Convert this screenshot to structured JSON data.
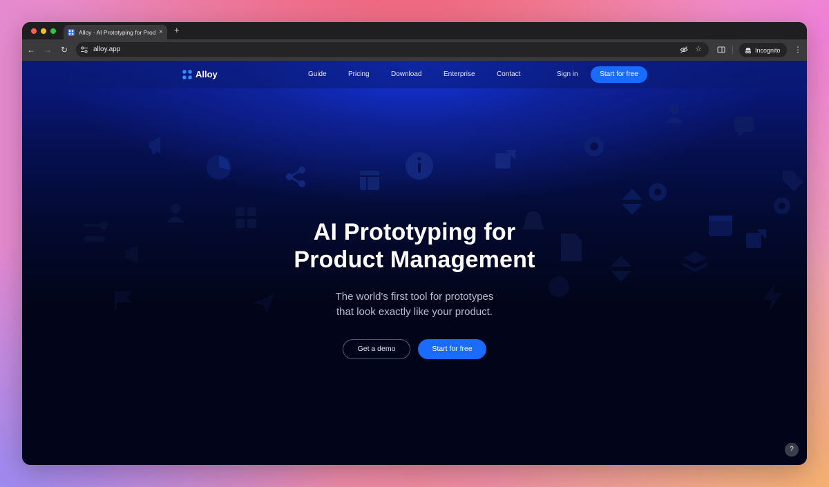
{
  "browser": {
    "tab_title": "Alloy · AI Prototyping for Product Management",
    "tab_close": "×",
    "new_tab": "+",
    "url": "alloy.app",
    "incognito_label": "Incognito",
    "menu": "⋮",
    "back": "←",
    "forward": "→",
    "reload": "↻",
    "star": "☆"
  },
  "site": {
    "brand": "Alloy",
    "nav": [
      "Guide",
      "Pricing",
      "Download",
      "Enterprise",
      "Contact"
    ],
    "sign_in": "Sign in",
    "cta_nav": "Start for free"
  },
  "hero": {
    "title_line1": "AI Prototyping for",
    "title_line2": "Product Management",
    "subtitle_line1": "The world's first tool for prototypes",
    "subtitle_line2": "that look exactly like your product.",
    "demo_button": "Get a demo",
    "start_button": "Start for free"
  },
  "help": "?",
  "colors": {
    "accent": "#1a6bff",
    "page_bg": "#020519"
  }
}
